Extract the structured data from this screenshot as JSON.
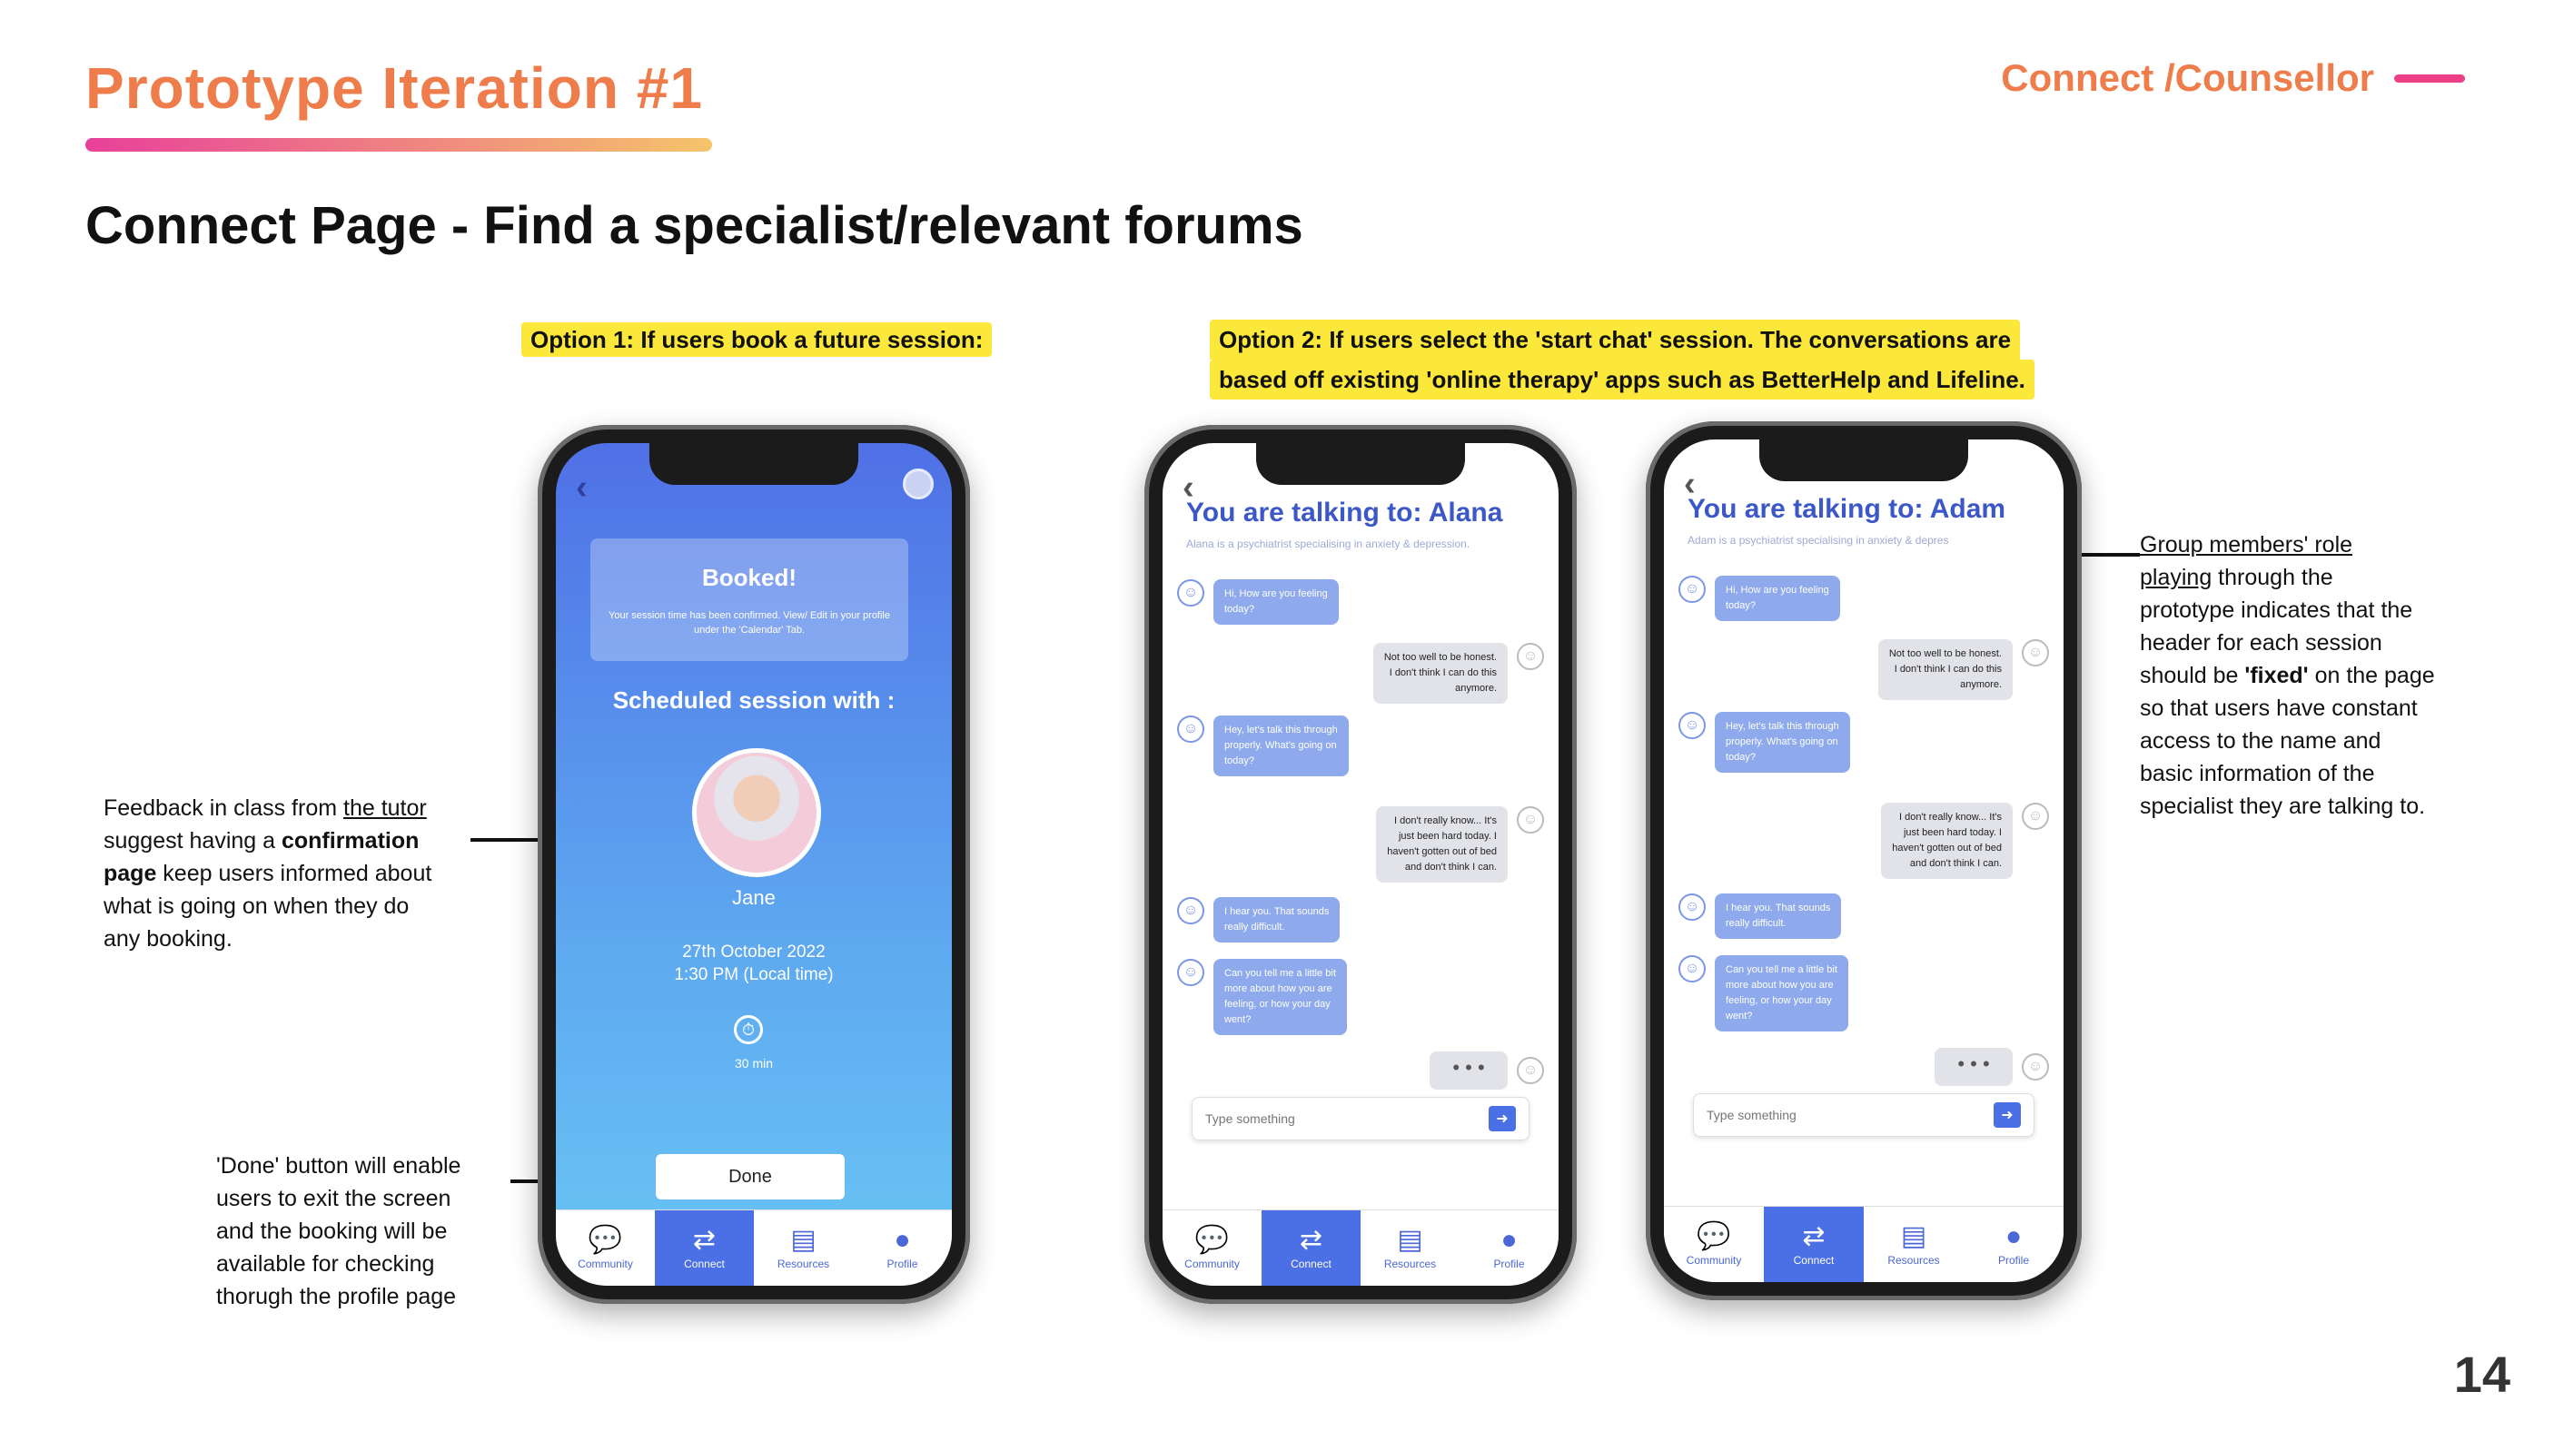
{
  "header": {
    "title": "Prototype Iteration #1",
    "section": "Connect /Counsellor",
    "subtitle": "Connect Page - Find a specialist/relevant forums"
  },
  "option1": {
    "label": "Option 1: If users book a future session:"
  },
  "option2": {
    "label_line1": "Option 2: If users select the 'start chat' session. The conversations are",
    "label_line2": "based off existing 'online therapy' apps such as BetterHelp and Lifeline."
  },
  "notes": {
    "feedback": {
      "l1_pre": "Feedback in class from ",
      "l1_link": "the tutor",
      "l2_pre": "suggest having a ",
      "l2_bold": "confirmation",
      "l3_bold": "page",
      "l3_post": " keep users informed about",
      "l4": "what is going on when they do",
      "l5": "any booking."
    },
    "done": {
      "l1": "'Done' button will enable",
      "l2": "users to exit the screen",
      "l3": "and the booking will be",
      "l4": "available for checking",
      "l5": "thorugh the profile page"
    },
    "group": {
      "l1_link": "Group members' role",
      "l2_link": "playing",
      "l2_post": " through the",
      "l3": "prototype indicates that the",
      "l4": "header for each session",
      "l5_pre": "should be ",
      "l5_bold": "'fixed'",
      "l5_post": " on the page",
      "l6": "so that users have constant",
      "l7": "access to the name and",
      "l8": "basic information of the",
      "l9": "specialist they are talking to."
    }
  },
  "booking": {
    "card_title": "Booked!",
    "card_desc": "Your session time has been confirmed. View/ Edit in your profile under the 'Calendar' Tab.",
    "scheduled": "Scheduled session with :",
    "name": "Jane",
    "date": "27th October 2022",
    "time": "1:30 PM (Local time)",
    "duration": "30 min",
    "done": "Done"
  },
  "nav": [
    "Community",
    "Connect",
    "Resources",
    "Profile"
  ],
  "chat1": {
    "prefix": "You are talking to: ",
    "name": "Alana",
    "sub": "Alana is a psychiatrist specialising in anxiety & depression."
  },
  "chat2": {
    "prefix": "You are talking to: ",
    "name": "Adam",
    "sub": "Adam is a psychiatrist specialising in anxiety & depres"
  },
  "messages": [
    {
      "from": "t",
      "lines": [
        "Hi, How are you feeling",
        "today?"
      ]
    },
    {
      "from": "m",
      "lines": [
        "Not too well to be honest.",
        "I don't think I can do this",
        "anymore."
      ]
    },
    {
      "from": "t",
      "lines": [
        "Hey, let's talk this through",
        "properly. What's going on",
        "today?"
      ]
    },
    {
      "from": "m",
      "lines": [
        "I don't really know... It's",
        "just been hard today. I",
        "haven't gotten out of bed",
        "and don't think I can."
      ]
    },
    {
      "from": "t",
      "lines": [
        "I hear you. That sounds",
        "really difficult."
      ]
    },
    {
      "from": "t",
      "lines": [
        "Can you tell me a little bit",
        "more about how you are",
        "feeling, or how your day",
        "went?"
      ]
    }
  ],
  "typing": "• • •",
  "input_placeholder": "Type something",
  "page_number": "14"
}
